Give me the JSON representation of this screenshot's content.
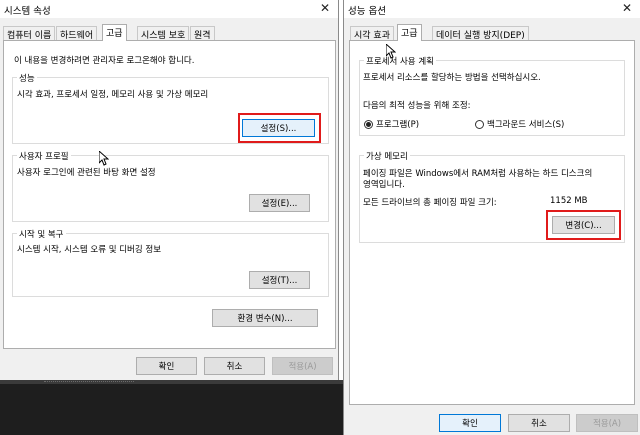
{
  "left_dialog": {
    "title": "시스템 속성",
    "close_glyph": "✕",
    "tabs": [
      "컴퓨터 이름",
      "하드웨어",
      "고급",
      "시스템 보호",
      "원격"
    ],
    "intro": "이 내용을 변경하려면 관리자로 로그온해야 합니다.",
    "performance": {
      "label": "성능",
      "description": "시각 효과, 프로세서 일정, 메모리 사용 및 가상 메모리",
      "button": "설정(S)..."
    },
    "user_profiles": {
      "label": "사용자 프로필",
      "description": "사용자 로그인에 관련된 바탕 화면 설정",
      "button": "설정(E)..."
    },
    "startup_recovery": {
      "label": "시작 및 복구",
      "description": "시스템 시작, 시스템 오류 및 디버깅 정보",
      "button": "설정(T)..."
    },
    "env_button": "환경 변수(N)...",
    "ok": "확인",
    "cancel": "취소",
    "apply": "적용(A)"
  },
  "right_dialog": {
    "title": "성능 옵션",
    "close_glyph": "✕",
    "tabs": [
      "시각 효과",
      "고급",
      "데이터 실행 방지(DEP)"
    ],
    "scheduling": {
      "label": "프로세서 사용 계획",
      "description": "프로세서 리소스를 할당하는 방법을 선택하십시오.",
      "prompt": "다음의 최적 성능을 위해 조정:",
      "option_programs": "프로그램(P)",
      "option_background": "백그라운드 서비스(S)",
      "selected": "programs"
    },
    "virtual_memory": {
      "label": "가상 메모리",
      "description_line1": "페이징 파일은 Windows에서 RAM처럼 사용하는 하드 디스크의",
      "description_line2": "영역입니다.",
      "total_label": "모든 드라이브의 총 페이징 파일 크기:",
      "total_value": "1152 MB",
      "change_button": "변경(C)..."
    },
    "ok": "확인",
    "cancel": "취소",
    "apply": "적용(A)"
  },
  "highlight_color": "#e01b1b",
  "focus_color": "#0078d7"
}
